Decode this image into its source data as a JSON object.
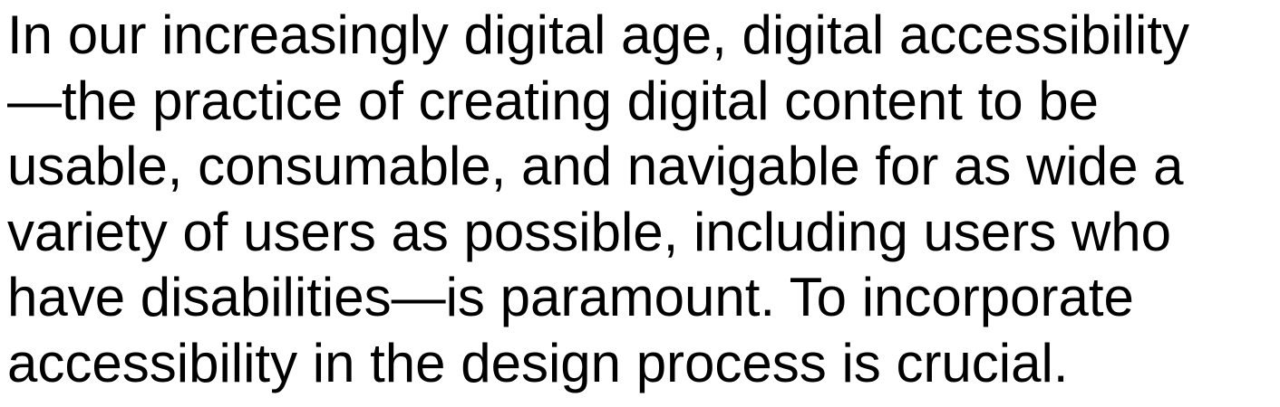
{
  "document": {
    "lines": [
      "In our increasingly digital age, digital accessibility",
      "—the practice of creating digital content to be",
      "usable, consumable, and navigable for as wide a",
      "variety of users as possible, including users who",
      "have disabilities—is paramount. To incorporate",
      "accessibility in the design process is crucial."
    ]
  }
}
